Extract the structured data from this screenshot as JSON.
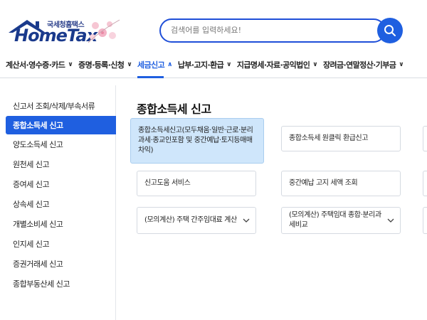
{
  "brand": {
    "korean_name": "국세청홈택스",
    "name": "HomeTax"
  },
  "search": {
    "placeholder": "검색어를 입력하세요!"
  },
  "nav": {
    "items": [
      {
        "label": "계산서·영수증·카드",
        "chevron": "∨"
      },
      {
        "label": "증명·등록·신청",
        "chevron": "∨"
      },
      {
        "label": "세금신고",
        "chevron": "∧"
      },
      {
        "label": "납부·고지·환급",
        "chevron": "∨"
      },
      {
        "label": "지급명세·자료·공익법인",
        "chevron": "∨"
      },
      {
        "label": "장려금·연말정산·기부금",
        "chevron": "∨"
      }
    ]
  },
  "sidebar": {
    "items": [
      {
        "label": "신고서 조회/삭제/부속서류"
      },
      {
        "label": "종합소득세 신고"
      },
      {
        "label": "양도소득세 신고"
      },
      {
        "label": "원천세 신고"
      },
      {
        "label": "증여세 신고"
      },
      {
        "label": "상속세 신고"
      },
      {
        "label": "개별소비세 신고"
      },
      {
        "label": "인지세 신고"
      },
      {
        "label": "증권거래세 신고"
      },
      {
        "label": "종합부동산세 신고"
      }
    ]
  },
  "main": {
    "title": "종합소득세 신고",
    "cards": [
      {
        "label": "종합소득세신고(모두채움·일반·근로·분리과세·종교인포함 및 중간예납·토지등매매차익)"
      },
      {
        "label": "종합소득세 원클릭 환급신고"
      },
      {
        "label": "신고도움 서비스"
      },
      {
        "label": "중간예납 고지 세액 조회"
      },
      {
        "label": "(모의계산) 주택 간주임대료 계산"
      },
      {
        "label": "(모의계산) 주택임대 종합·분리과세비교"
      }
    ]
  },
  "colors": {
    "accent": "#1f5fe0",
    "highlight_card": "#cfe6fb",
    "brand_navy": "#1a3a8c"
  }
}
